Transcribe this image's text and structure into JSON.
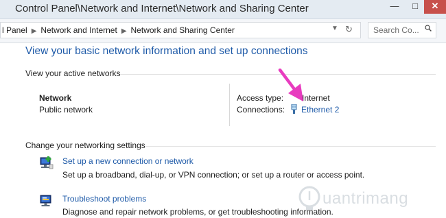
{
  "window": {
    "title": "Control Panel\\Network and Internet\\Network and Sharing Center",
    "minimize_label": "—",
    "maximize_label": "□",
    "close_label": "✕"
  },
  "address_bar": {
    "breadcrumbs": [
      "l Panel",
      "Network and Internet",
      "Network and Sharing Center"
    ],
    "separator": "▶",
    "dropdown_icon": "chevron-down-icon",
    "refresh_icon": "refresh-icon"
  },
  "search": {
    "placeholder": "Search Co...",
    "icon": "search-icon"
  },
  "main": {
    "heading": "View your basic network information and set up connections",
    "active_networks": {
      "section_title": "View your active networks",
      "network_name": "Network",
      "network_type": "Public network",
      "access_type_label": "Access type:",
      "access_type_value": "Internet",
      "connections_label": "Connections:",
      "connection_name": "Ethernet 2",
      "connection_icon": "ethernet-plug-icon",
      "annotation": "magenta-arrow"
    },
    "change_settings": {
      "section_title": "Change your networking settings",
      "items": [
        {
          "icon": "network-setup-icon",
          "title": "Set up a new connection or network",
          "description": "Set up a broadband, dial-up, or VPN connection; or set up a router or access point."
        },
        {
          "icon": "troubleshoot-icon",
          "title": "Troubleshoot problems",
          "description": "Diagnose and repair network problems, or get troubleshooting information."
        }
      ]
    }
  },
  "watermark": {
    "text": "uantrimang",
    "icon": "lightbulb-icon"
  },
  "colors": {
    "link": "#1e5aa8",
    "arrow": "#e83cbf",
    "titlebar": "#e4ebf2",
    "close_button": "#c7504b"
  }
}
